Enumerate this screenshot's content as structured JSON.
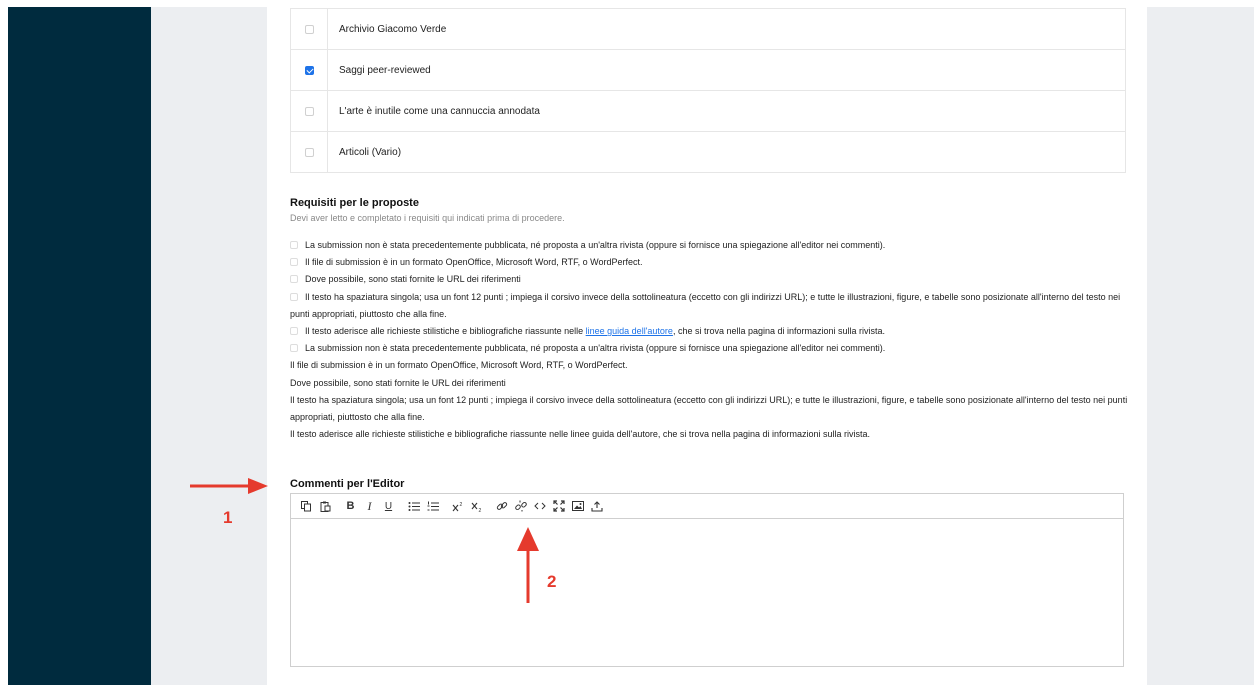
{
  "sections": [
    {
      "label": "Archivio Giacomo Verde",
      "checked": false
    },
    {
      "label": "Saggi peer-reviewed",
      "checked": true
    },
    {
      "label": "L'arte è inutile come una cannuccia annodata",
      "checked": false
    },
    {
      "label": "Articoli (Vario)",
      "checked": false
    }
  ],
  "requirements": {
    "title": "Requisiti per le proposte",
    "description": "Devi aver letto e completato i requisiti qui indicati prima di procedere.",
    "items": [
      "La submission non è stata precedentemente pubblicata, né proposta a un'altra rivista (oppure si fornisce una spiegazione all'editor nei commenti).",
      "Il file di submission è in un formato OpenOffice, Microsoft Word, RTF, o WordPerfect.",
      "Dove possibile, sono stati fornite le URL dei riferimenti",
      "Il testo ha spaziatura singola; usa un font 12 punti ; impiega il corsivo invece della sottolineatura (eccetto con gli indirizzi URL); e tutte le illustrazioni, figure, e tabelle sono posizionate all'interno del testo nei punti appropriati, piuttosto che alla fine."
    ],
    "guide_item": {
      "before": "Il testo aderisce alle richieste stilistiche e bibliografiche riassunte nelle ",
      "link": "linee guida dell'autore",
      "after": ", che si trova nella pagina di informazioni sulla rivista."
    },
    "repeat_item": "La submission non è stata precedentemente pubblicata, né proposta a un'altra rivista (oppure si fornisce una spiegazione all'editor nei commenti).",
    "plain_lines": [
      "Il file di submission è in un formato OpenOffice, Microsoft Word, RTF, o WordPerfect.",
      "Dove possibile, sono stati fornite le URL dei riferimenti",
      "Il testo ha spaziatura singola; usa un font 12 punti ; impiega il corsivo invece della sottolineatura (eccetto con gli indirizzi URL); e tutte le illustrazioni, figure, e tabelle sono posizionate all'interno del testo nei punti appropriati, piuttosto che alla fine.",
      "Il testo aderisce alle richieste stilistiche e bibliografiche riassunte nelle linee guida dell'autore, che si trova nella pagina di informazioni sulla rivista."
    ]
  },
  "comments": {
    "title": "Commenti per l'Editor",
    "toolbar": [
      "copy-icon",
      "paste-icon",
      "bold-icon",
      "italic-icon",
      "underline-icon",
      "bullet-list-icon",
      "numbered-list-icon",
      "superscript-icon",
      "subscript-icon",
      "link-icon",
      "unlink-icon",
      "code-icon",
      "fullscreen-icon",
      "image-icon",
      "upload-icon"
    ],
    "toolbar_glyphs": {
      "bold": "B",
      "italic": "I",
      "underline": "U"
    }
  },
  "annotations": {
    "label_1": "1",
    "label_2": "2",
    "color": "#e53a2d"
  }
}
